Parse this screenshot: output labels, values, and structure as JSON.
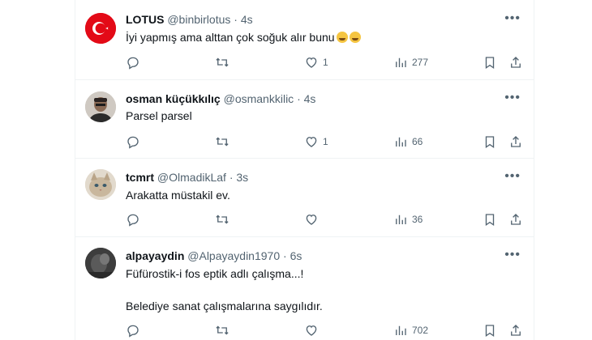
{
  "tweets": [
    {
      "name": "LOTUS",
      "handle": "@binbirlotus",
      "time": "4s",
      "text": "İyi yapmış ama alttan çok soğuk alır bunu",
      "avatar": "turkish-flag",
      "replies": "",
      "retweets": "",
      "likes": "1",
      "views": "277"
    },
    {
      "name": "osman küçükkılıç",
      "handle": "@osmankkilic",
      "time": "4s",
      "text": "Parsel parsel",
      "avatar": "man-portrait",
      "replies": "",
      "retweets": "",
      "likes": "1",
      "views": "66"
    },
    {
      "name": "tcmrt",
      "handle": "@OlmadikLaf",
      "time": "3s",
      "text": "Arakatta müstakil ev.",
      "avatar": "cat-photo",
      "replies": "",
      "retweets": "",
      "likes": "",
      "views": "36"
    },
    {
      "name": "alpayaydin",
      "handle": "@Alpayaydin1970",
      "time": "6s",
      "text": "Füfürostik-i fos eptik adlı çalışma...!\n\nBelediye sanat çalışmalarına saygılıdır.",
      "avatar": "dark-photo",
      "replies": "",
      "retweets": "",
      "likes": "",
      "views": "702"
    }
  ],
  "icons": {
    "reply": "reply-icon",
    "retweet": "retweet-icon",
    "like": "heart-icon",
    "views": "views-icon",
    "bookmark": "bookmark-icon",
    "share": "share-icon",
    "more": "more-icon"
  },
  "colors": {
    "text": "#0f1419",
    "secondary": "#536471",
    "divider": "#eff3f4",
    "flag_red": "#e30a17"
  },
  "separator": "·",
  "more_glyph": "•••"
}
